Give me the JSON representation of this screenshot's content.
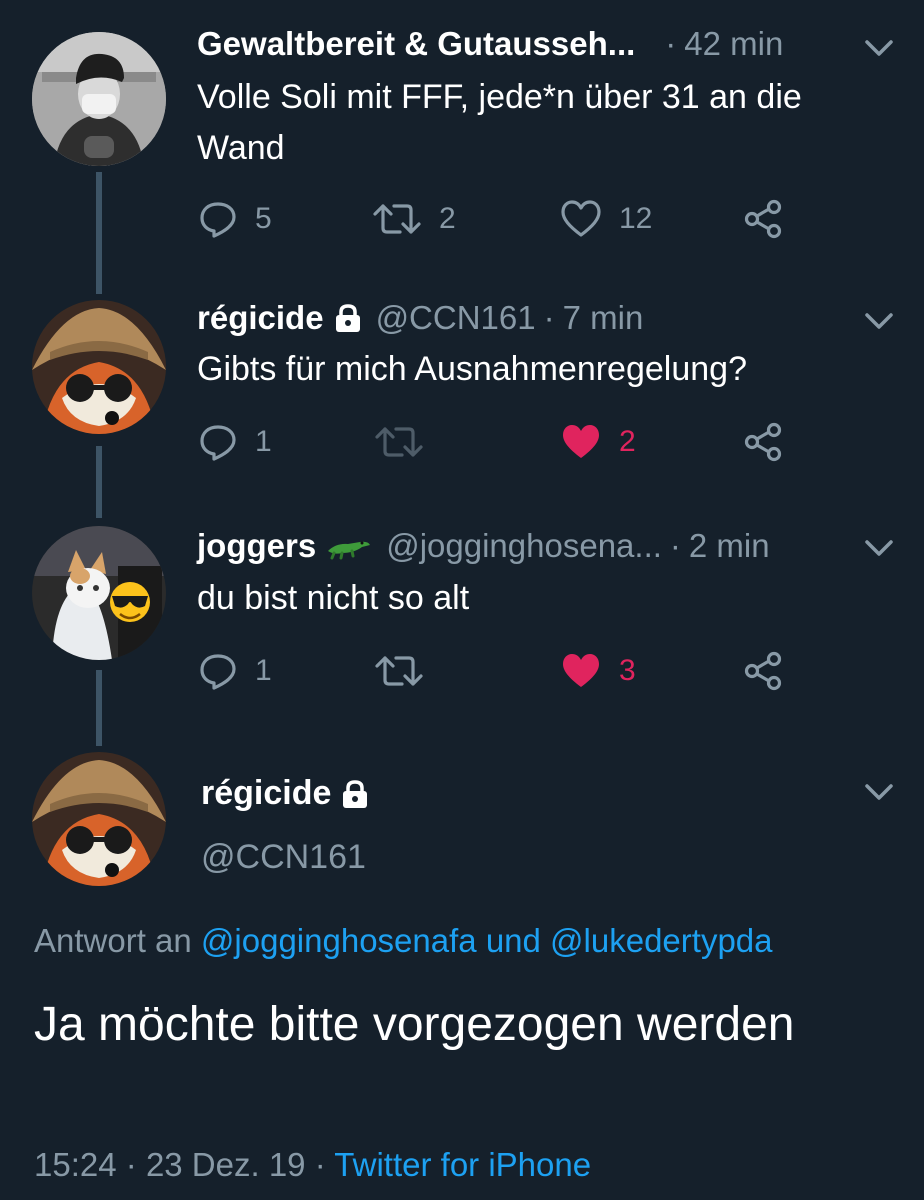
{
  "colors": {
    "background": "#15202b",
    "secondary_text": "#8899a6",
    "link": "#1da1f2",
    "like": "#e0245e",
    "thread_line": "#3d5466"
  },
  "tweets": [
    {
      "display_name": "Gewaltbereit & Gutausseh...",
      "handle": "",
      "separator": "·",
      "time": "42 min",
      "text": "Volle Soli mit FFF, jede*n über 31 an die Wand",
      "replies": "5",
      "retweets": "2",
      "likes": "12",
      "liked": false
    },
    {
      "display_name": "régicide",
      "handle": "@CCN161",
      "separator": "·",
      "time": "7 min",
      "text": "Gibts für mich Ausnahmenregelung?",
      "replies": "1",
      "retweets": "",
      "likes": "2",
      "liked": true
    },
    {
      "display_name": "joggers",
      "handle": "@jogginghosena...",
      "separator": "·",
      "time": "2 min",
      "text": "du bist nicht so alt",
      "replies": "1",
      "retweets": "",
      "likes": "3",
      "liked": true
    }
  ],
  "focused": {
    "display_name": "régicide",
    "handle": "@CCN161",
    "reply_prefix": "Antwort an",
    "reply_user1": "@jogginghosenafa",
    "reply_and": "und",
    "reply_user2": "@lukedertypda",
    "text": "Ja möchte bitte vorgezogen werden",
    "time": "15:24",
    "separator": "·",
    "date": "23 Dez. 19",
    "source": "Twitter for iPhone"
  },
  "icons": [
    "reply-icon",
    "retweet-icon",
    "heart-icon",
    "share-icon",
    "lock-icon",
    "chevron-down-icon",
    "crocodile-emoji",
    "sunglasses-emoji"
  ]
}
